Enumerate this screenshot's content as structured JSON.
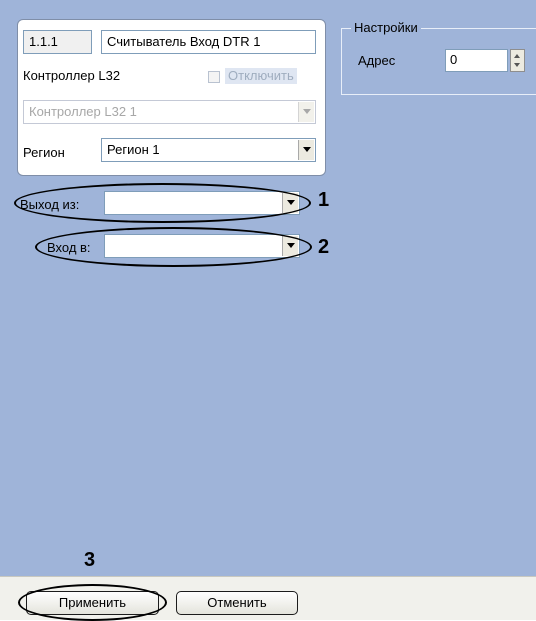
{
  "object": {
    "id": "1.1.1",
    "name": "Считыватель Вход DTR 1",
    "controller_label": "Контроллер L32",
    "disable_label": "Отключить",
    "controller_select": "Контроллер L32 1",
    "region_label": "Регион",
    "region_select": "Регион 1"
  },
  "settings": {
    "legend": "Настройки",
    "address_label": "Адрес",
    "address_value": "0"
  },
  "exit_from": {
    "label": "Выход из:",
    "value": ""
  },
  "enter_to": {
    "label": "Вход в:",
    "value": ""
  },
  "callouts": {
    "c1": "1",
    "c2": "2",
    "c3": "3"
  },
  "buttons": {
    "apply": "Применить",
    "cancel": "Отменить"
  }
}
